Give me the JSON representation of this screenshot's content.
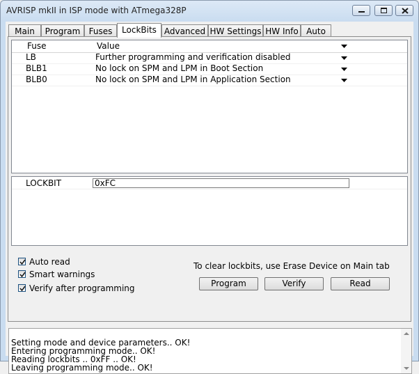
{
  "window": {
    "title": "AVRISP mkII in ISP mode with ATmega328P"
  },
  "tabs": [
    {
      "label": "Main"
    },
    {
      "label": "Program"
    },
    {
      "label": "Fuses"
    },
    {
      "label": "LockBits"
    },
    {
      "label": "Advanced"
    },
    {
      "label": "HW Settings"
    },
    {
      "label": "HW Info"
    },
    {
      "label": "Auto"
    }
  ],
  "active_tab": "LockBits",
  "lockbits_table": {
    "headers": {
      "fuse": "Fuse",
      "value": "Value"
    },
    "rows": [
      {
        "fuse": "LB",
        "value": "Further programming and verification disabled"
      },
      {
        "fuse": "BLB1",
        "value": "No lock on SPM and LPM in Boot Section"
      },
      {
        "fuse": "BLB0",
        "value": "No lock on SPM and LPM in Application Section"
      }
    ]
  },
  "lockbit_register": {
    "label": "LOCKBIT",
    "value": "0xFC"
  },
  "options": [
    {
      "label": "Auto read",
      "checked": true
    },
    {
      "label": "Smart warnings",
      "checked": true
    },
    {
      "label": "Verify after programming",
      "checked": true
    }
  ],
  "hint": "To clear lockbits, use Erase Device on Main tab",
  "buttons": {
    "program": "Program",
    "verify": "Verify",
    "read": "Read"
  },
  "log": {
    "lines": [
      "Setting mode and device parameters.. OK!",
      "Entering programming mode.. OK!",
      "Reading lockbits .. 0xFF .. OK!",
      "Leaving programming mode.. OK!"
    ]
  },
  "icons": {
    "minimize": "minimize-icon",
    "maximize": "maximize-icon",
    "close": "close-icon",
    "dropdown": "chevron-down-icon",
    "checkmark": "checkmark-icon"
  }
}
